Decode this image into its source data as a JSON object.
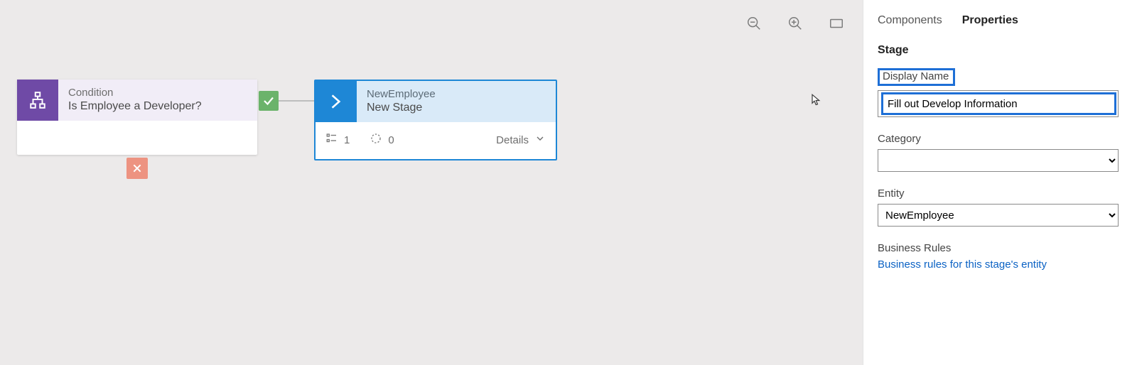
{
  "toolbar": {
    "zoom_out": "Zoom out",
    "zoom_in": "Zoom in",
    "fit": "Fit to screen"
  },
  "canvas": {
    "condition": {
      "kind_label": "Condition",
      "title": "Is Employee a Developer?"
    },
    "stage": {
      "entity_label": "NewEmployee",
      "title": "New Stage",
      "steps_count": "1",
      "datasteps_count": "0",
      "details_label": "Details"
    }
  },
  "panel": {
    "tabs": {
      "components": "Components",
      "properties": "Properties",
      "active": "properties"
    },
    "section_title": "Stage",
    "display_name": {
      "label": "Display Name",
      "value": "Fill out Develop Information"
    },
    "category": {
      "label": "Category",
      "value": ""
    },
    "entity": {
      "label": "Entity",
      "value": "NewEmployee"
    },
    "business_rules": {
      "label": "Business Rules",
      "link": "Business rules for this stage's entity"
    }
  }
}
